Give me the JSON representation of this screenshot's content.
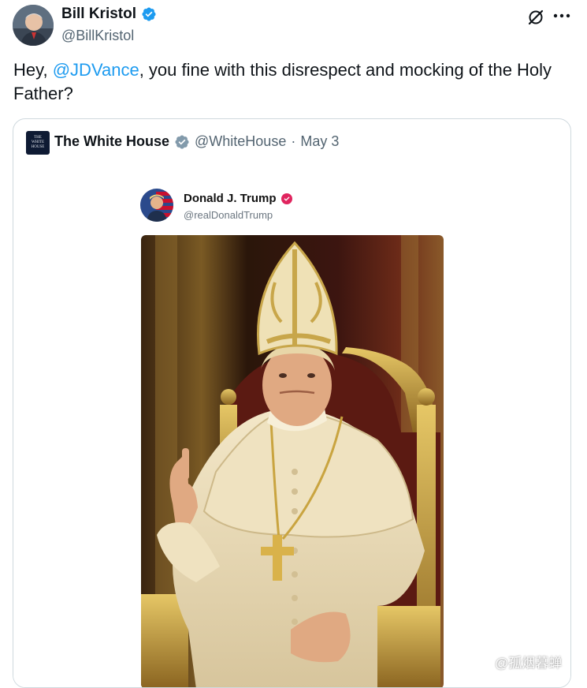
{
  "author": {
    "display_name": "Bill Kristol",
    "handle": "@BillKristol",
    "avatar_icon": "person-avatar-icon",
    "verified_color": "#1d9bf0"
  },
  "tweet": {
    "text_before": "Hey, ",
    "mention": "@JDVance",
    "text_after": ", you fine with this disrespect and mocking of the Holy Father?"
  },
  "quoted": {
    "display_name": "The White House",
    "handle": "@WhiteHouse",
    "separator": "·",
    "date": "May 3",
    "avatar_text": [
      "THE",
      "WHITE",
      "HOUSE"
    ],
    "verified_color": "#829aab"
  },
  "embedded": {
    "display_name": "Donald J. Trump",
    "handle": "@realDonaldTrump",
    "verified_color": "#e0245e",
    "image_icon": "pope-portrait-image"
  },
  "watermark": {
    "text": "@孤烟暮蝉"
  }
}
